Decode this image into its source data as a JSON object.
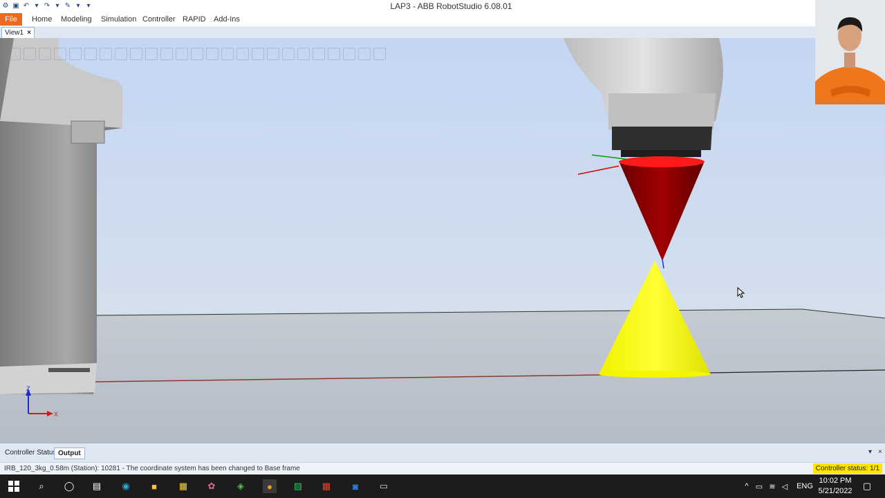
{
  "window": {
    "title": "LAP3 - ABB RobotStudio 6.08.01"
  },
  "ribbon": {
    "tabs": [
      "File",
      "Home",
      "Modeling",
      "Simulation",
      "Controller",
      "RAPID",
      "Add-Ins"
    ]
  },
  "document": {
    "tab_label": "View1",
    "close_glyph": "×"
  },
  "viewport": {
    "axis_z_label": "Z",
    "axis_x_label": "X",
    "colors": {
      "red_cone": "#8b0000",
      "yellow_cone": "#ffff00",
      "background_top": "#c6d7f2",
      "floor": "#b9c2cc"
    }
  },
  "output_panel": {
    "tabs": [
      "Controller Status",
      "Output"
    ],
    "selected_tab": "Output",
    "pin_glyph": "▾",
    "close_glyph": "×"
  },
  "status_bar": {
    "message": "IRB_120_3kg_0.58m (Station): 10281 - The coordinate system has been changed to Base frame",
    "controller_status": "Controller status: 1/1"
  },
  "taskbar": {
    "tray_lang": "ENG",
    "time": "10:02 PM",
    "date": "5/21/2022",
    "icons": [
      "windows-start-icon",
      "search-icon",
      "cortana-icon",
      "task-view-icon",
      "edge-icon",
      "file-explorer-icon",
      "store-icon",
      "paint-icon",
      "app-green-icon",
      "robotstudio-icon",
      "clion-icon",
      "app-red-icon",
      "zalo-icon",
      "app-window-icon"
    ]
  }
}
